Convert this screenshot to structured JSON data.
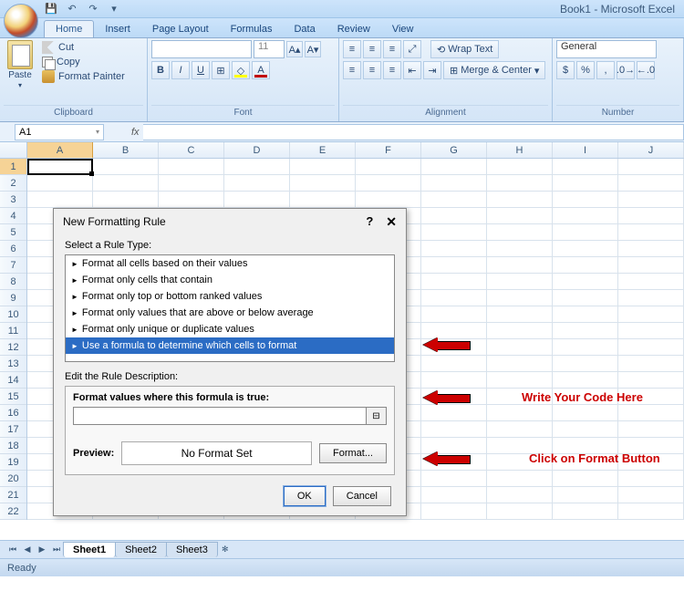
{
  "app": {
    "title": "Book1 - Microsoft Excel"
  },
  "tabs": [
    "Home",
    "Insert",
    "Page Layout",
    "Formulas",
    "Data",
    "Review",
    "View"
  ],
  "activeTab": "Home",
  "ribbon": {
    "clipboard": {
      "label": "Clipboard",
      "paste": "Paste",
      "cut": "Cut",
      "copy": "Copy",
      "painter": "Format Painter"
    },
    "font": {
      "label": "Font",
      "size": "11",
      "bold": "B",
      "italic": "I",
      "underline": "U"
    },
    "alignment": {
      "label": "Alignment",
      "wrap": "Wrap Text",
      "merge": "Merge & Center"
    },
    "number": {
      "label": "Number",
      "format": "General",
      "currency": "$",
      "percent": "%",
      "comma": ","
    }
  },
  "namebox": "A1",
  "fx": "fx",
  "columns": [
    "A",
    "B",
    "C",
    "D",
    "E",
    "F",
    "G",
    "H",
    "I",
    "J"
  ],
  "rowCount": 22,
  "sheets": [
    "Sheet1",
    "Sheet2",
    "Sheet3"
  ],
  "activeSheet": "Sheet1",
  "status": "Ready",
  "dialog": {
    "title": "New Formatting Rule",
    "help": "?",
    "close": "✕",
    "selectType": "Select a Rule Type:",
    "rules": [
      "Format all cells based on their values",
      "Format only cells that contain",
      "Format only top or bottom ranked values",
      "Format only values that are above or below average",
      "Format only unique or duplicate values",
      "Use a formula to determine which cells to format"
    ],
    "selectedRule": 5,
    "editDesc": "Edit the Rule Description:",
    "formulaLabel": "Format values where this formula is true:",
    "formulaValue": "",
    "previewLabel": "Preview:",
    "previewText": "No Format Set",
    "formatBtn": "Format...",
    "ok": "OK",
    "cancel": "Cancel"
  },
  "annotations": {
    "writeCode": "Write Your Code Here",
    "clickFormat": "Click on Format Button"
  }
}
